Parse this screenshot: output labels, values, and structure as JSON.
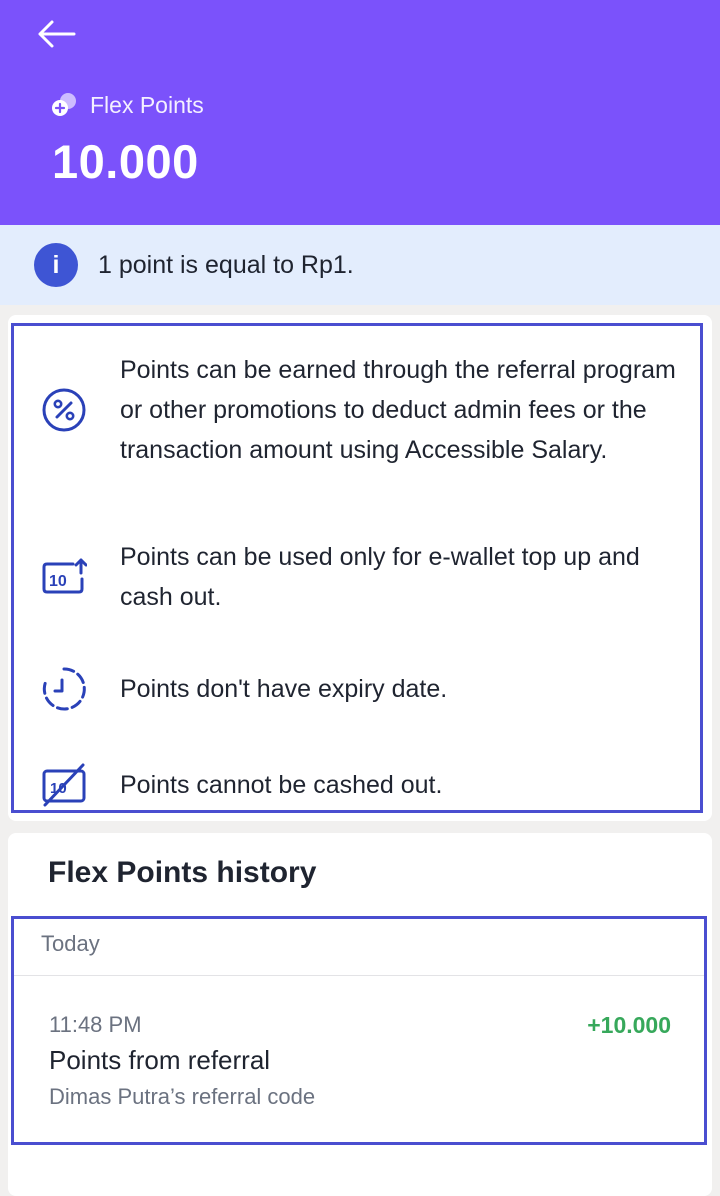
{
  "header": {
    "label": "Flex Points",
    "value": "10.000"
  },
  "info": {
    "text": "1 point is equal to Rp1."
  },
  "rules": [
    {
      "icon": "percent-coin-icon",
      "text": "Points can be earned through the referral program or other promotions to deduct admin fees or the transaction amount using Accessible Salary."
    },
    {
      "icon": "cash-topup-icon",
      "text": "Points can be used only for e-wallet top up and cash out."
    },
    {
      "icon": "clock-icon",
      "text": "Points don't have expiry date."
    },
    {
      "icon": "no-cash-icon",
      "text": "Points cannot be cashed out."
    }
  ],
  "history": {
    "title": "Flex Points history",
    "groups": [
      {
        "day": "Today",
        "items": [
          {
            "time": "11:48 PM",
            "amount": "+10.000",
            "title": "Points from referral",
            "subtitle": "Dimas Putra’s referral code"
          }
        ]
      }
    ]
  },
  "colors": {
    "header_bg": "#7b52fb",
    "accent_blue": "#3e55d4",
    "positive_green": "#37a85b",
    "info_bg": "#e3edfd"
  }
}
